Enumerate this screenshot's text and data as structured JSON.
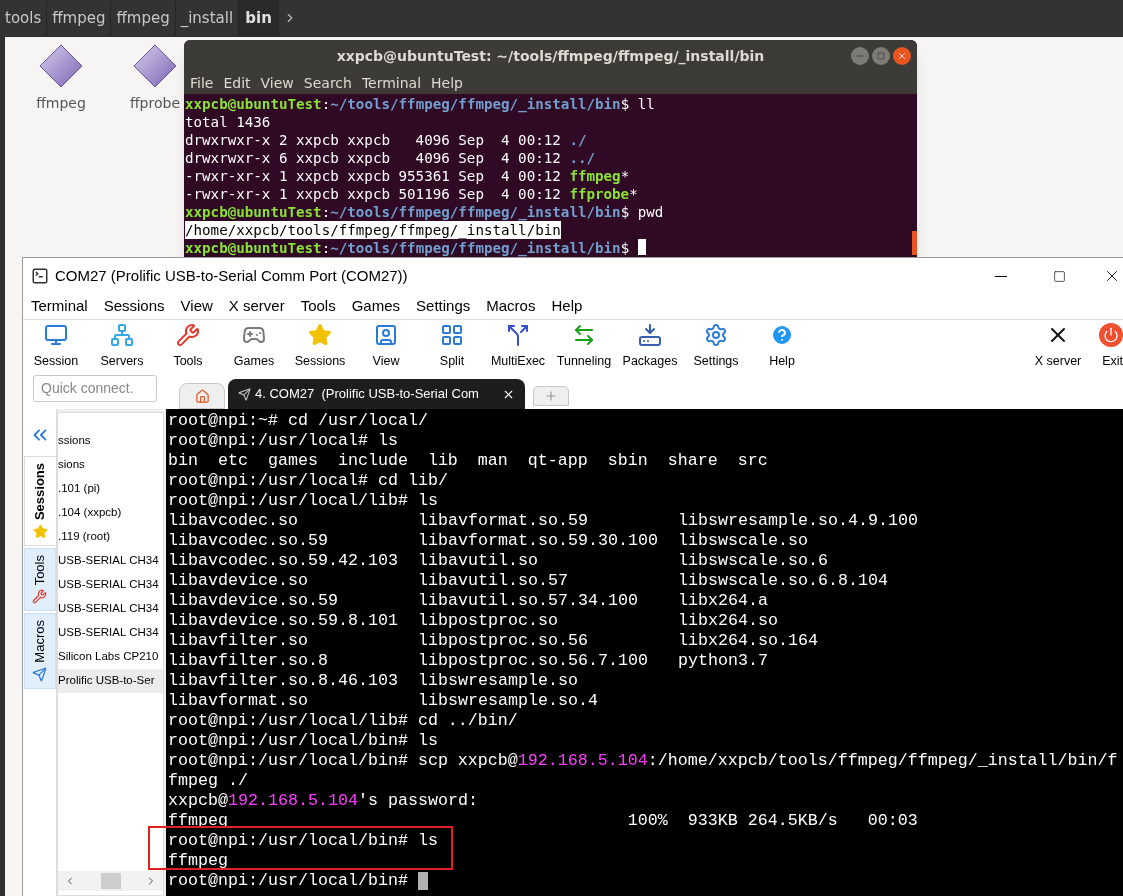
{
  "file_manager": {
    "breadcrumbs": [
      {
        "label": "tools",
        "selected": false
      },
      {
        "label": "ffmpeg",
        "selected": false
      },
      {
        "label": "ffmpeg",
        "selected": false
      },
      {
        "label": "_install",
        "selected": false
      },
      {
        "label": "bin",
        "selected": true
      }
    ],
    "files": [
      {
        "name": "ffmpeg"
      },
      {
        "name": "ffprobe"
      }
    ]
  },
  "ubuntu_terminal": {
    "title": "xxpcb@ubuntuTest: ~/tools/ffmpeg/ffmpeg/_install/bin",
    "menu": [
      "File",
      "Edit",
      "View",
      "Search",
      "Terminal",
      "Help"
    ],
    "lines": [
      [
        {
          "kind": "user",
          "text": "xxpcb@ubuntuTest"
        },
        {
          "kind": "plain",
          "text": ":"
        },
        {
          "kind": "path",
          "text": "~/tools/ffmpeg/ffmpeg/_install/bin"
        },
        {
          "kind": "plain",
          "text": "$ ll"
        }
      ],
      [
        {
          "kind": "plain",
          "text": "total 1436"
        }
      ],
      [
        {
          "kind": "plain",
          "text": "drwxrwxr-x 2 xxpcb xxpcb   4096 Sep  4 00:12 "
        },
        {
          "kind": "path",
          "text": "./"
        }
      ],
      [
        {
          "kind": "plain",
          "text": "drwxrwxr-x 6 xxpcb xxpcb   4096 Sep  4 00:12 "
        },
        {
          "kind": "path",
          "text": "../"
        }
      ],
      [
        {
          "kind": "plain",
          "text": "-rwxr-xr-x 1 xxpcb xxpcb 955361 Sep  4 00:12 "
        },
        {
          "kind": "user",
          "text": "ffmpeg"
        },
        {
          "kind": "plain",
          "text": "*"
        }
      ],
      [
        {
          "kind": "plain",
          "text": "-rwxr-xr-x 1 xxpcb xxpcb 501196 Sep  4 00:12 "
        },
        {
          "kind": "user",
          "text": "ffprobe"
        },
        {
          "kind": "plain",
          "text": "*"
        }
      ],
      [
        {
          "kind": "user",
          "text": "xxpcb@ubuntuTest"
        },
        {
          "kind": "plain",
          "text": ":"
        },
        {
          "kind": "path",
          "text": "~/tools/ffmpeg/ffmpeg/_install/bin"
        },
        {
          "kind": "plain",
          "text": "$ pwd"
        }
      ],
      [
        {
          "kind": "selected",
          "text": "/home/xxpcb/tools/ffmpeg/ffmpeg/_install/bin"
        }
      ],
      [
        {
          "kind": "user",
          "text": "xxpcb@ubuntuTest"
        },
        {
          "kind": "plain",
          "text": ":"
        },
        {
          "kind": "path",
          "text": "~/tools/ffmpeg/ffmpeg/_install/bin"
        },
        {
          "kind": "plain",
          "text": "$ "
        }
      ]
    ]
  },
  "mobaxterm": {
    "title": "COM27  (Prolific USB-to-Serial Comm Port (COM27))",
    "menu": [
      "Terminal",
      "Sessions",
      "View",
      "X server",
      "Tools",
      "Games",
      "Settings",
      "Macros",
      "Help"
    ],
    "toolbar": [
      {
        "label": "Session"
      },
      {
        "label": "Servers"
      },
      {
        "label": "Tools"
      },
      {
        "label": "Games"
      },
      {
        "label": "Sessions"
      },
      {
        "label": "View"
      },
      {
        "label": "Split"
      },
      {
        "label": "MultiExec"
      },
      {
        "label": "Tunneling"
      },
      {
        "label": "Packages"
      },
      {
        "label": "Settings"
      },
      {
        "label": "Help"
      }
    ],
    "toolbar_right": [
      {
        "label": "X server"
      },
      {
        "label": "Exit"
      }
    ],
    "quick_connect": {
      "placeholder": "Quick connect."
    },
    "tabs": [
      {
        "kind": "home",
        "selected": false
      },
      {
        "kind": "session",
        "label": "4. COM27  (Prolific USB-to-Serial Com",
        "selected": true
      }
    ],
    "side_tabs": [
      {
        "label": "Sessions",
        "selected": true
      },
      {
        "label": "Tools",
        "selected": false
      },
      {
        "label": "Macros",
        "selected": false
      }
    ],
    "sessions": [
      {
        "label": "ssions",
        "selected": false
      },
      {
        "label": "sions",
        "selected": false
      },
      {
        "label": ".101 (pi)",
        "selected": false
      },
      {
        "label": ".104 (xxpcb)",
        "selected": false
      },
      {
        "label": ".119 (root)",
        "selected": false
      },
      {
        "label": "USB-SERIAL CH34",
        "selected": false
      },
      {
        "label": "USB-SERIAL CH34",
        "selected": false
      },
      {
        "label": "USB-SERIAL CH34",
        "selected": false
      },
      {
        "label": "USB-SERIAL CH34",
        "selected": false
      },
      {
        "label": "Silicon Labs CP210",
        "selected": false
      },
      {
        "label": "Prolific USB-to-Ser",
        "selected": true
      }
    ],
    "terminal_lines": [
      {
        "kind": "text",
        "segments": [
          {
            "kind": "plain",
            "text": "root@npi:~# cd /usr/local/"
          }
        ]
      },
      {
        "kind": "text",
        "segments": [
          {
            "kind": "plain",
            "text": "root@npi:/usr/local# ls"
          }
        ]
      },
      {
        "kind": "text",
        "segments": [
          {
            "kind": "plain",
            "text": "bin  etc  games  include  lib  man  qt-app  sbin  share  src"
          }
        ]
      },
      {
        "kind": "text",
        "segments": [
          {
            "kind": "plain",
            "text": "root@npi:/usr/local# cd lib/"
          }
        ]
      },
      {
        "kind": "text",
        "segments": [
          {
            "kind": "plain",
            "text": "root@npi:/usr/local/lib# ls"
          }
        ]
      },
      {
        "kind": "columns",
        "cells": [
          "libavcodec.so",
          "libavformat.so.59",
          "libswresample.so.4.9.100"
        ]
      },
      {
        "kind": "columns",
        "cells": [
          "libavcodec.so.59",
          "libavformat.so.59.30.100",
          "libswscale.so"
        ]
      },
      {
        "kind": "columns",
        "cells": [
          "libavcodec.so.59.42.103",
          "libavutil.so",
          "libswscale.so.6"
        ]
      },
      {
        "kind": "columns",
        "cells": [
          "libavdevice.so",
          "libavutil.so.57",
          "libswscale.so.6.8.104"
        ]
      },
      {
        "kind": "columns",
        "cells": [
          "libavdevice.so.59",
          "libavutil.so.57.34.100",
          "libx264.a"
        ]
      },
      {
        "kind": "columns",
        "cells": [
          "libavdevice.so.59.8.101",
          "libpostproc.so",
          "libx264.so"
        ]
      },
      {
        "kind": "columns",
        "cells": [
          "libavfilter.so",
          "libpostproc.so.56",
          "libx264.so.164"
        ]
      },
      {
        "kind": "columns",
        "cells": [
          "libavfilter.so.8",
          "libpostproc.so.56.7.100",
          "python3.7"
        ]
      },
      {
        "kind": "columns",
        "cells": [
          "libavfilter.so.8.46.103",
          "libswresample.so"
        ]
      },
      {
        "kind": "columns",
        "cells": [
          "libavformat.so",
          "libswresample.so.4"
        ]
      },
      {
        "kind": "text",
        "segments": [
          {
            "kind": "plain",
            "text": "root@npi:/usr/local/lib# cd ../bin/"
          }
        ]
      },
      {
        "kind": "text",
        "segments": [
          {
            "kind": "plain",
            "text": "root@npi:/usr/local/bin# ls"
          }
        ]
      },
      {
        "kind": "text",
        "segments": [
          {
            "kind": "plain",
            "text": "root@npi:/usr/local/bin# scp xxpcb@"
          },
          {
            "kind": "host",
            "text": "192.168.5.104"
          },
          {
            "kind": "plain",
            "text": ":/home/xxpcb/tools/ffmpeg/ffmpeg/_install/bin/f"
          }
        ]
      },
      {
        "kind": "text",
        "segments": [
          {
            "kind": "plain",
            "text": "fmpeg ./"
          }
        ]
      },
      {
        "kind": "text",
        "segments": [
          {
            "kind": "plain",
            "text": "xxpcb@"
          },
          {
            "kind": "host",
            "text": "192.168.5.104"
          },
          {
            "kind": "plain",
            "text": "'s password:"
          }
        ]
      },
      {
        "kind": "text",
        "segments": [
          {
            "kind": "plain",
            "text": "ffmpeg                                        100%  933KB 264.5KB/s   00:03"
          }
        ]
      },
      {
        "kind": "text",
        "segments": [
          {
            "kind": "plain",
            "text": "root@npi:/usr/local/bin# ls"
          }
        ]
      },
      {
        "kind": "text",
        "segments": [
          {
            "kind": "plain",
            "text": "ffmpeg"
          }
        ]
      },
      {
        "kind": "text",
        "segments": [
          {
            "kind": "plain",
            "text": "root@npi:/usr/local/bin# "
          }
        ]
      }
    ]
  }
}
